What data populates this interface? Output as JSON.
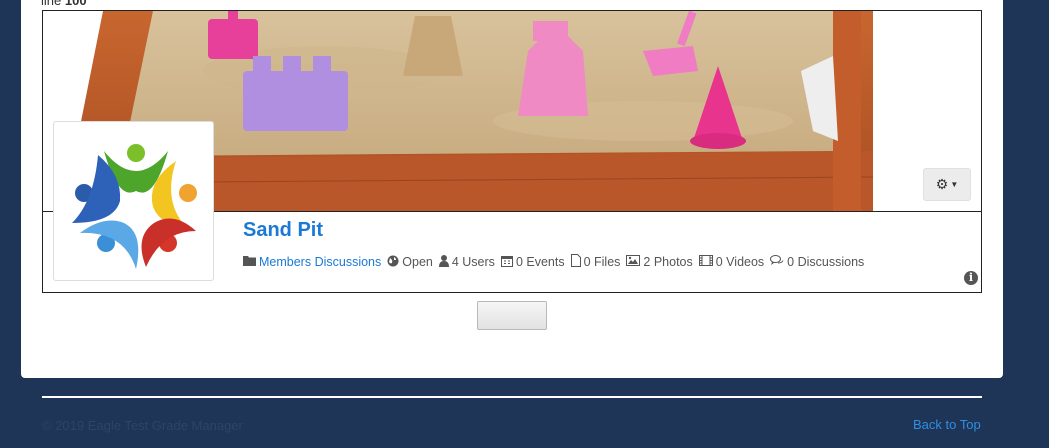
{
  "top_note": {
    "prefix": "line",
    "value": "100"
  },
  "group": {
    "title": "Sand Pit",
    "category": "Members Discussions",
    "privacy": "Open",
    "users": "4 Users",
    "events": "0 Events",
    "files": "0 Files",
    "photos": "2 Photos",
    "videos": "0 Videos",
    "discussions": "0 Discussions"
  },
  "icons": {
    "settings": "gear-icon",
    "category": "folder-icon",
    "privacy": "globe-icon",
    "users": "user-icon",
    "events": "calendar-icon",
    "files": "file-icon",
    "photos": "image-icon",
    "videos": "film-icon",
    "discussions": "comments-icon",
    "info": "info-icon"
  },
  "footer": {
    "copyright": "© 2019 Eagle Test Grade Manager",
    "back_to_top": "Back to Top"
  },
  "colors": {
    "background": "#1f3557",
    "link": "#1a7ad6",
    "footer_link": "#2f8fe0"
  }
}
